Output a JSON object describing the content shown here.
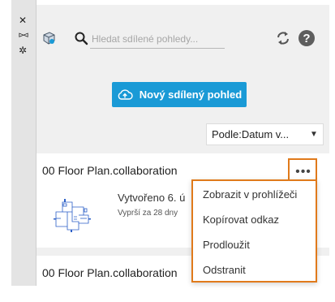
{
  "toolbar": {
    "close_glyph": "✕",
    "pin_glyph": "⊳⊲",
    "settings_glyph": "✲"
  },
  "header": {
    "search_placeholder": "Hledat sdílené pohledy..."
  },
  "new_button_label": "Nový sdílený pohled",
  "sort": {
    "label": "Podle:",
    "value": "Datum v..."
  },
  "cards": [
    {
      "title": "00 Floor Plan.collaboration",
      "created": "Vytvořeno 6. ú",
      "expires": "Vyprší za 28 dny",
      "more_label": "•••"
    },
    {
      "title": "00 Floor Plan.collaboration"
    }
  ],
  "context_menu": {
    "items": [
      "Zobrazit v prohlížeči",
      "Kopírovat odkaz",
      "Prodloužit",
      "Odstranit"
    ]
  },
  "colors": {
    "accent": "#1a9ad6",
    "highlight": "#e07a1b"
  }
}
